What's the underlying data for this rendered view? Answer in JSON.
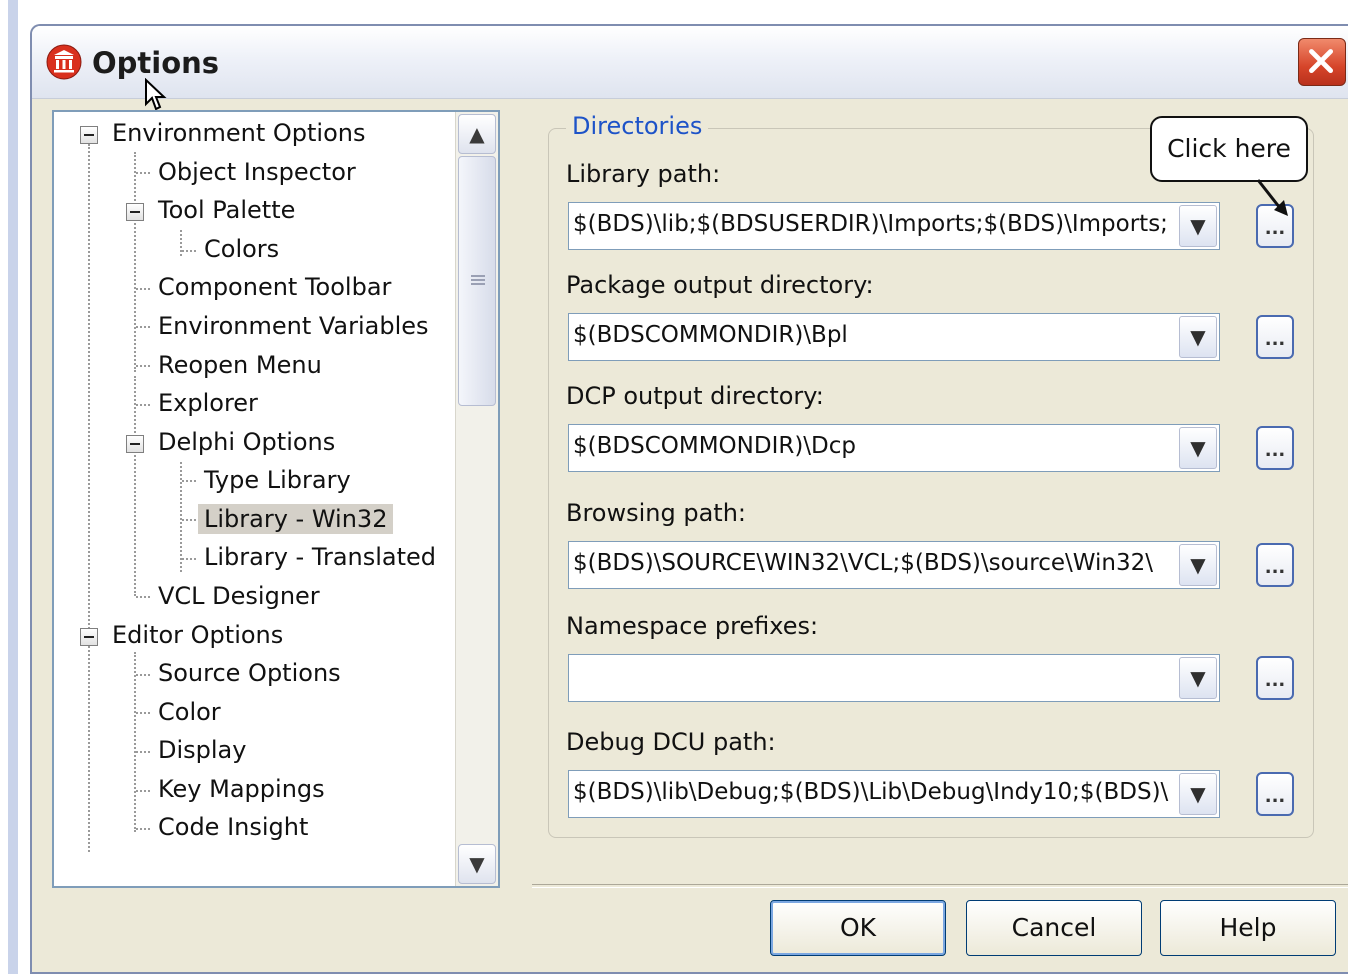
{
  "window": {
    "title": "Options"
  },
  "tree": {
    "items": [
      {
        "label": "Environment Options"
      },
      {
        "label": "Object Inspector"
      },
      {
        "label": "Tool Palette"
      },
      {
        "label": "Colors"
      },
      {
        "label": "Component Toolbar"
      },
      {
        "label": "Environment Variables"
      },
      {
        "label": "Reopen Menu"
      },
      {
        "label": "Explorer"
      },
      {
        "label": "Delphi Options"
      },
      {
        "label": "Type Library"
      },
      {
        "label": "Library - Win32",
        "selected": true
      },
      {
        "label": "Library - Translated"
      },
      {
        "label": "VCL Designer"
      },
      {
        "label": "Editor Options"
      },
      {
        "label": "Source Options"
      },
      {
        "label": "Color"
      },
      {
        "label": "Display"
      },
      {
        "label": "Key Mappings"
      },
      {
        "label": "Code Insight"
      }
    ]
  },
  "directories": {
    "group_title": "Directories",
    "fields": [
      {
        "label": "Library path:",
        "value": "$(BDS)\\lib;$(BDSUSERDIR)\\Imports;$(BDS)\\Imports;"
      },
      {
        "label": "Package output directory:",
        "value": "$(BDSCOMMONDIR)\\Bpl"
      },
      {
        "label": "DCP output directory:",
        "value": "$(BDSCOMMONDIR)\\Dcp"
      },
      {
        "label": "Browsing path:",
        "value": "$(BDS)\\SOURCE\\WIN32\\VCL;$(BDS)\\source\\Win32\\"
      },
      {
        "label": "Namespace prefixes:",
        "value": ""
      },
      {
        "label": "Debug DCU path:",
        "value": "$(BDS)\\lib\\Debug;$(BDS)\\Lib\\Debug\\Indy10;$(BDS)\\"
      }
    ],
    "browse_label": "...",
    "dropdown_glyph": "▼"
  },
  "callout": {
    "text": "Click here"
  },
  "buttons": {
    "ok": "OK",
    "cancel": "Cancel",
    "help": "Help"
  },
  "scroll": {
    "up": "▲",
    "down": "▼"
  },
  "colors": {
    "group_title": "#1d53c8",
    "close_button": "#d6452a"
  }
}
